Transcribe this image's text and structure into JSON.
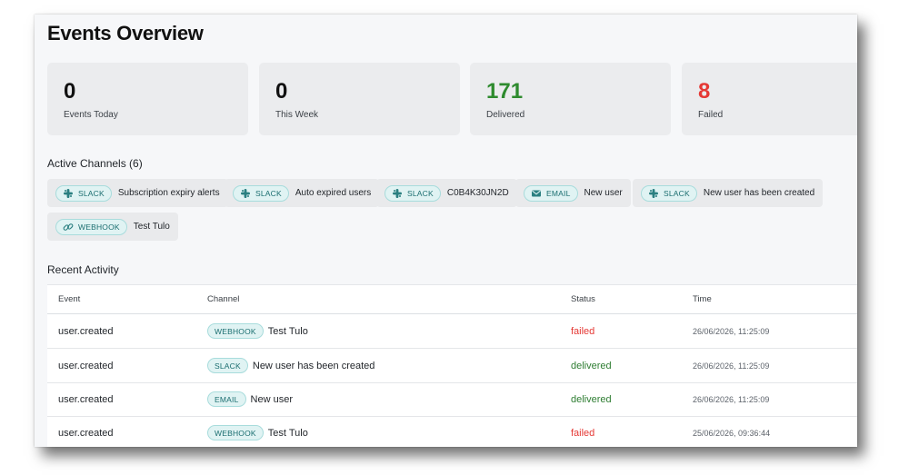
{
  "page": {
    "title": "Events Overview"
  },
  "stats": [
    {
      "value": "0",
      "label": "Events Today",
      "color": "#111111"
    },
    {
      "value": "0",
      "label": "This Week",
      "color": "#111111"
    },
    {
      "value": "171",
      "label": "Delivered",
      "color": "#2e8b2e"
    },
    {
      "value": "8",
      "label": "Failed",
      "color": "#e53935"
    }
  ],
  "channels": {
    "title": "Active Channels (6)",
    "items": [
      {
        "type": "SLACK",
        "icon": "slack-icon",
        "name": "Subscription expiry alerts"
      },
      {
        "type": "SLACK",
        "icon": "slack-icon",
        "name": "Auto expired users"
      },
      {
        "type": "SLACK",
        "icon": "slack-icon",
        "name": "C0B4K30JN2D"
      },
      {
        "type": "EMAIL",
        "icon": "mail-icon",
        "name": "New user"
      },
      {
        "type": "SLACK",
        "icon": "slack-icon",
        "name": "New user has been created"
      },
      {
        "type": "WEBHOOK",
        "icon": "link-icon",
        "name": "Test Tulo"
      }
    ]
  },
  "activity": {
    "title": "Recent Activity",
    "columns": {
      "event": "Event",
      "channel": "Channel",
      "status": "Status",
      "time": "Time"
    },
    "rows": [
      {
        "event": "user.created",
        "channel_type": "WEBHOOK",
        "channel_name": "Test Tulo",
        "status": "failed",
        "time": "26/06/2026, 11:25:09"
      },
      {
        "event": "user.created",
        "channel_type": "SLACK",
        "channel_name": "New user has been created",
        "status": "delivered",
        "time": "26/06/2026, 11:25:09"
      },
      {
        "event": "user.created",
        "channel_type": "EMAIL",
        "channel_name": "New user",
        "status": "delivered",
        "time": "26/06/2026, 11:25:09"
      },
      {
        "event": "user.created",
        "channel_type": "WEBHOOK",
        "channel_name": "Test Tulo",
        "status": "failed",
        "time": "25/06/2026, 09:36:44"
      }
    ]
  },
  "colors": {
    "accent": "#1b6e70",
    "failed": "#e53935",
    "delivered": "#2e7d32"
  }
}
